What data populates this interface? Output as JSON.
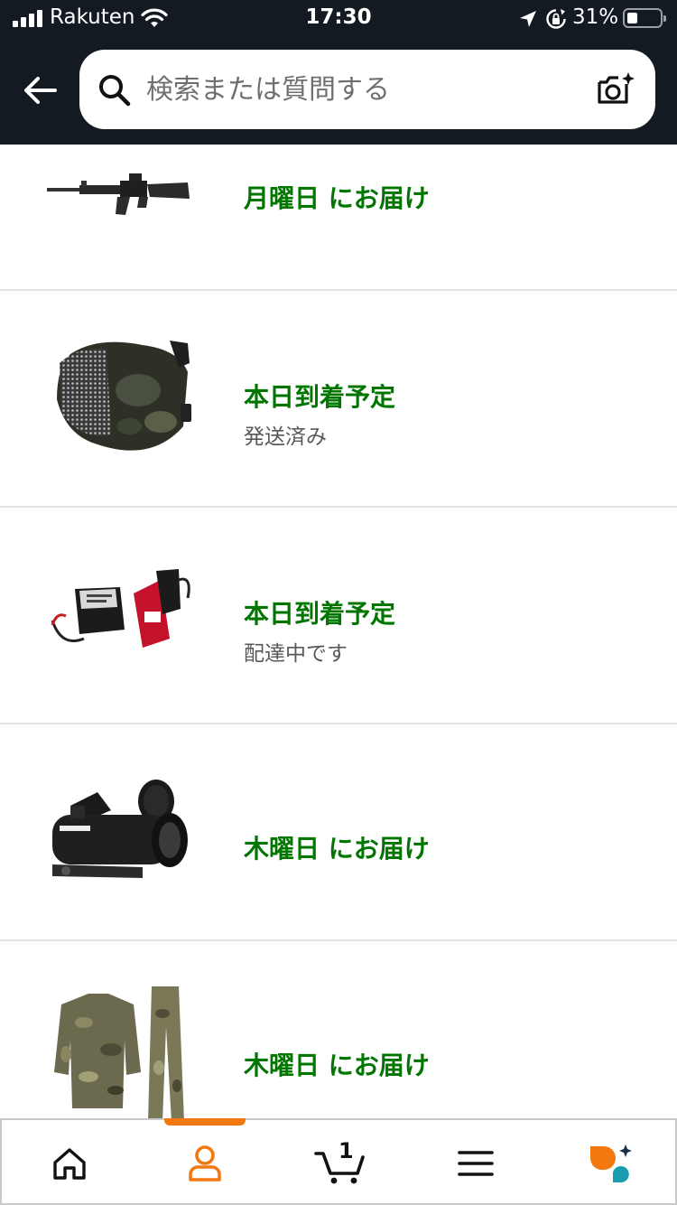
{
  "status_bar": {
    "carrier": "Rakuten",
    "time": "17:30",
    "battery": "31%",
    "battery_level": 0.31
  },
  "header": {
    "back_icon": "arrow-left-icon",
    "search": {
      "placeholder": "検索または質問する",
      "value": "",
      "icon": "search-icon"
    },
    "camera_icon": "camera-sparkle-icon"
  },
  "orders": [
    {
      "product": "rifle",
      "status": "月曜日 にお届け",
      "detail": ""
    },
    {
      "product": "mesh-mask",
      "status": "本日到着予定",
      "detail": "発送済み"
    },
    {
      "product": "battery-charger",
      "status": "本日到着予定",
      "detail": "配達中です"
    },
    {
      "product": "red-dot-sight",
      "status": "木曜日 にお届け",
      "detail": ""
    },
    {
      "product": "camo-uniform",
      "status": "木曜日 にお届け",
      "detail": ""
    }
  ],
  "colors": {
    "header_bg": "#131a22",
    "delivery_green": "#007600",
    "accent_orange": "#f2780f",
    "divider": "#e3e3e3"
  },
  "tabbar": {
    "tabs": [
      {
        "name": "home",
        "icon": "home-icon"
      },
      {
        "name": "account",
        "icon": "person-icon",
        "active": true
      },
      {
        "name": "cart",
        "icon": "cart-icon"
      },
      {
        "name": "menu",
        "icon": "hamburger-icon"
      },
      {
        "name": "rufus",
        "icon": "chat-sparkle-icon"
      }
    ],
    "cart_count": "1"
  }
}
